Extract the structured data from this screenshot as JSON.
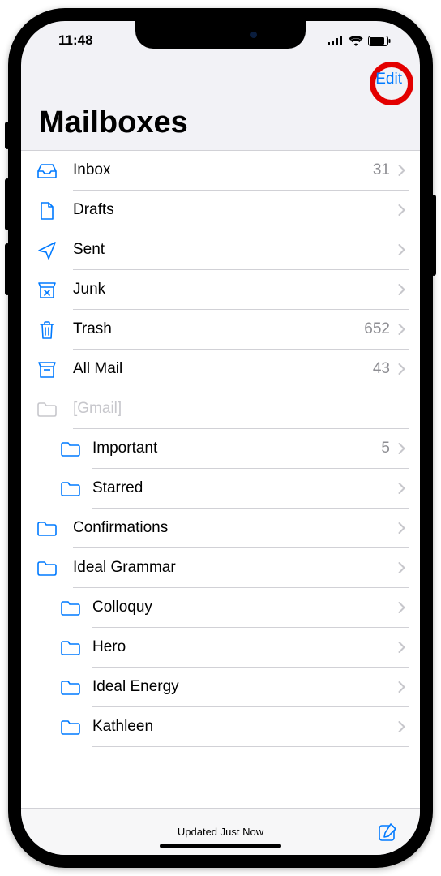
{
  "status": {
    "time": "11:48"
  },
  "nav": {
    "edit_label": "Edit"
  },
  "title": "Mailboxes",
  "footer": {
    "updated": "Updated Just Now"
  },
  "mailboxes": [
    {
      "icon": "inbox",
      "label": "Inbox",
      "count": "31",
      "indent": 0,
      "chevron": true,
      "muted": false
    },
    {
      "icon": "drafts",
      "label": "Drafts",
      "count": "",
      "indent": 0,
      "chevron": true,
      "muted": false
    },
    {
      "icon": "sent",
      "label": "Sent",
      "count": "",
      "indent": 0,
      "chevron": true,
      "muted": false
    },
    {
      "icon": "junk",
      "label": "Junk",
      "count": "",
      "indent": 0,
      "chevron": true,
      "muted": false
    },
    {
      "icon": "trash",
      "label": "Trash",
      "count": "652",
      "indent": 0,
      "chevron": true,
      "muted": false
    },
    {
      "icon": "allmail",
      "label": "All Mail",
      "count": "43",
      "indent": 0,
      "chevron": true,
      "muted": false
    },
    {
      "icon": "folder-muted",
      "label": "[Gmail]",
      "count": "",
      "indent": 0,
      "chevron": false,
      "muted": true
    },
    {
      "icon": "folder",
      "label": "Important",
      "count": "5",
      "indent": 1,
      "chevron": true,
      "muted": false
    },
    {
      "icon": "folder",
      "label": "Starred",
      "count": "",
      "indent": 1,
      "chevron": true,
      "muted": false
    },
    {
      "icon": "folder",
      "label": "Confirmations",
      "count": "",
      "indent": 0,
      "chevron": true,
      "muted": false
    },
    {
      "icon": "folder",
      "label": "Ideal Grammar",
      "count": "",
      "indent": 0,
      "chevron": true,
      "muted": false
    },
    {
      "icon": "folder",
      "label": "Colloquy",
      "count": "",
      "indent": 1,
      "chevron": true,
      "muted": false
    },
    {
      "icon": "folder",
      "label": "Hero",
      "count": "",
      "indent": 1,
      "chevron": true,
      "muted": false
    },
    {
      "icon": "folder",
      "label": "Ideal Energy",
      "count": "",
      "indent": 1,
      "chevron": true,
      "muted": false
    },
    {
      "icon": "folder",
      "label": "Kathleen",
      "count": "",
      "indent": 1,
      "chevron": true,
      "muted": false
    }
  ]
}
